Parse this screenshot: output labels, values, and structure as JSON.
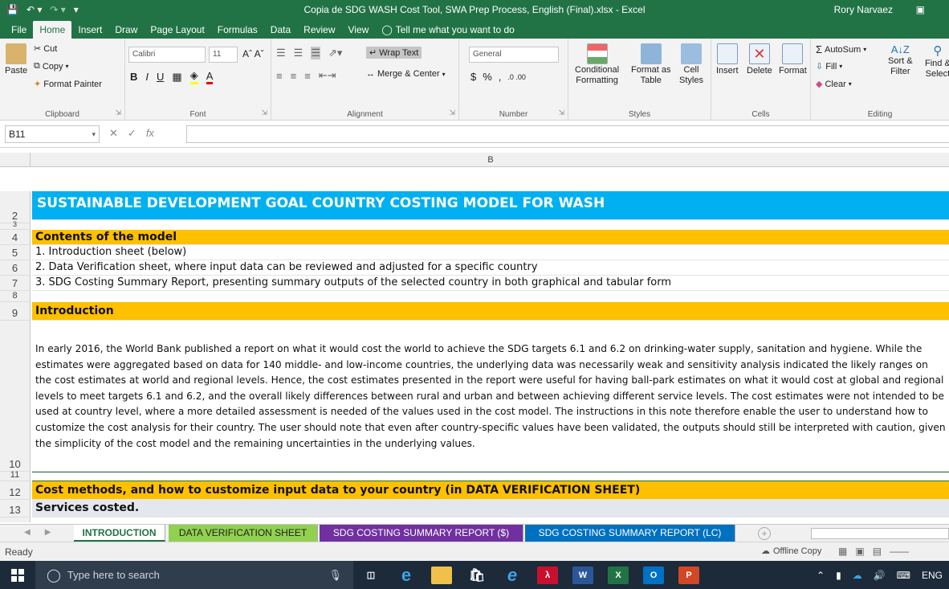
{
  "window": {
    "title": "Copia de SDG WASH Cost Tool, SWA Prep Process, English (Final).xlsx  -  Excel",
    "user": "Rory Narvaez"
  },
  "ribbon_tabs": [
    "File",
    "Home",
    "Insert",
    "Draw",
    "Page Layout",
    "Formulas",
    "Data",
    "Review",
    "View"
  ],
  "tell_me": "Tell me what you want to do",
  "clipboard": {
    "paste": "Paste",
    "cut": "Cut",
    "copy": "Copy",
    "format_painter": "Format Painter",
    "label": "Clipboard"
  },
  "font": {
    "name": "Calibri",
    "size": "11",
    "label": "Font"
  },
  "alignment": {
    "wrap": "Wrap Text",
    "merge": "Merge & Center",
    "label": "Alignment"
  },
  "number": {
    "format": "General",
    "currency": "$",
    "percent": "%",
    "comma": ",",
    "label": "Number"
  },
  "styles": {
    "conditional": "Conditional",
    "formatting": "Formatting",
    "format_as": "Format as",
    "table": "Table",
    "cell": "Cell",
    "cell_styles": "Styles",
    "label": "Styles"
  },
  "cells": {
    "insert": "Insert",
    "delete": "Delete",
    "format": "Format",
    "label": "Cells"
  },
  "editing": {
    "autosum": "AutoSum",
    "fill": "Fill",
    "clear": "Clear",
    "sort": "Sort &",
    "filter": "Filter",
    "find": "Find &",
    "select": "Select",
    "label": "Editing"
  },
  "formula_bar": {
    "name_box": "B11",
    "fx": "fx",
    "value": ""
  },
  "columns": {
    "b": "B"
  },
  "rows": [
    {
      "num": "2",
      "text": "SUSTAINABLE DEVELOPMENT GOAL COUNTRY COSTING MODEL FOR WASH"
    },
    {
      "num": "3",
      "text": ""
    },
    {
      "num": "4",
      "text": "Contents of the model"
    },
    {
      "num": "5",
      "text": "1. Introduction sheet (below)"
    },
    {
      "num": "6",
      "text": "2. Data Verification sheet, where input data can be reviewed and adjusted for a specific country"
    },
    {
      "num": "7",
      "text": "3. SDG Costing Summary Report, presenting summary outputs of the selected country in both graphical and tabular form"
    },
    {
      "num": "8",
      "text": ""
    },
    {
      "num": "9",
      "text": "Introduction"
    },
    {
      "num": "10",
      "text": "In early 2016, the World Bank published a report on what it would cost the world to achieve the SDG targets 6.1 and 6.2 on drinking-water supply, sanitation and hygiene. While the estimates were aggregated based on data for 140 middle- and low-income countries, the underlying data was necessarily weak and sensitivity analysis indicated the likely ranges on the cost estimates at world and regional levels. Hence, the cost estimates presented in the report were useful for having ball-park estimates on what it would cost at global and regional levels to meet targets 6.1 and 6.2, and the overall likely differences between rural and urban and between achieving different service levels. The cost estimates were not intended to be used at country level, where a more detailed assessment is needed of the values used in the cost model. The instructions in this note therefore enable the user to understand how to customize the cost analysis for their country. The user should note that even after country-specific values have been validated, the outputs should still be interpreted with caution, given the simplicity of the cost model and the remaining uncertainties in the underlying values."
    },
    {
      "num": "11",
      "text": ""
    },
    {
      "num": "12",
      "text": "Cost methods, and how to customize input data to your country (in DATA VERIFICATION SHEET)"
    },
    {
      "num": "13",
      "text": "Services costed."
    }
  ],
  "sheet_tabs": [
    {
      "label": "INTRODUCTION",
      "color": "#ffffff",
      "text_color": "#217346"
    },
    {
      "label": "DATA VERIFICATION SHEET",
      "color": "#92d050",
      "text_color": "#1f1f1f"
    },
    {
      "label": "SDG COSTING SUMMARY REPORT ($)",
      "color": "#7030a0",
      "text_color": "#ffffff"
    },
    {
      "label": "SDG COSTING SUMMARY REPORT (LC)",
      "color": "#0070c0",
      "text_color": "#ffffff"
    }
  ],
  "status": {
    "ready": "Ready",
    "offline": "Offline Copy"
  },
  "taskbar": {
    "search_placeholder": "Type here to search",
    "lang": "ENG"
  },
  "colors": {
    "excel_green": "#217346",
    "title_fill": "#00b0f0",
    "section_fill": "#ffc000",
    "sub_fill": "#e4e8ee"
  }
}
